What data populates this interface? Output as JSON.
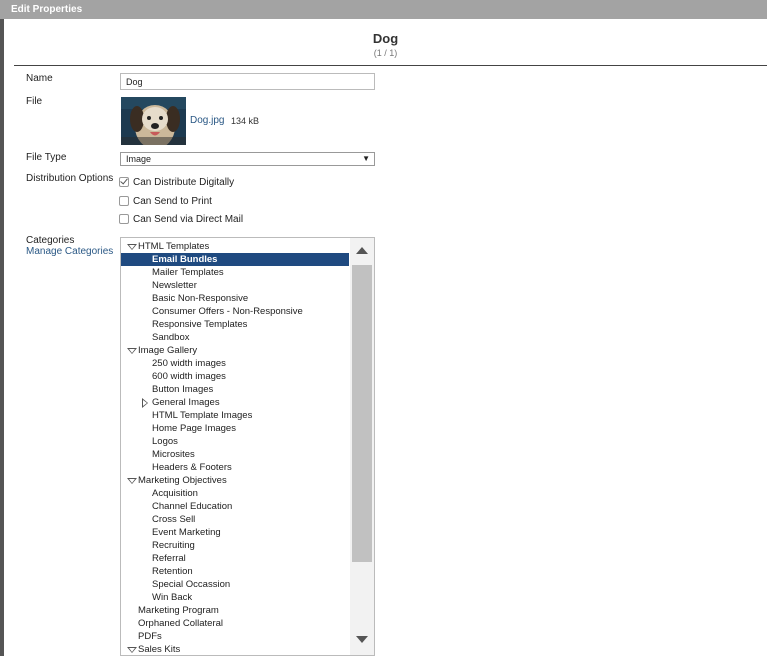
{
  "window": {
    "title": "Edit Properties"
  },
  "record": {
    "name": "Dog",
    "position": "(1 / 1)"
  },
  "fields": {
    "name_label": "Name",
    "name_value": "Dog",
    "file_label": "File",
    "file_name": "Dog.jpg",
    "file_size": "134 kB",
    "file_type_label": "File Type",
    "file_type_value": "Image",
    "distribution_label": "Distribution Options",
    "distribution_options": [
      {
        "label": "Can Distribute Digitally",
        "checked": true
      },
      {
        "label": "Can Send to Print",
        "checked": false
      },
      {
        "label": "Can Send via Direct Mail",
        "checked": false
      }
    ],
    "categories_label": "Categories",
    "manage_categories_link": "Manage Categories"
  },
  "categories": [
    {
      "label": "HTML Templates",
      "level": 0,
      "state": "expanded"
    },
    {
      "label": "Email Bundles",
      "level": 1,
      "selected": true
    },
    {
      "label": "Mailer Templates",
      "level": 1
    },
    {
      "label": "Newsletter",
      "level": 1
    },
    {
      "label": "Basic Non-Responsive",
      "level": 1
    },
    {
      "label": "Consumer Offers - Non-Responsive",
      "level": 1
    },
    {
      "label": "Responsive Templates",
      "level": 1
    },
    {
      "label": "Sandbox",
      "level": 1
    },
    {
      "label": "Image Gallery",
      "level": 0,
      "state": "expanded"
    },
    {
      "label": "250 width images",
      "level": 1
    },
    {
      "label": "600 width images",
      "level": 1
    },
    {
      "label": "Button Images",
      "level": 1
    },
    {
      "label": "General Images",
      "level": 1,
      "state": "collapsed"
    },
    {
      "label": "HTML Template Images",
      "level": 1
    },
    {
      "label": "Home Page Images",
      "level": 1
    },
    {
      "label": "Logos",
      "level": 1
    },
    {
      "label": "Microsites",
      "level": 1
    },
    {
      "label": "Headers & Footers",
      "level": 1
    },
    {
      "label": "Marketing Objectives",
      "level": 0,
      "state": "expanded"
    },
    {
      "label": "Acquisition",
      "level": 1
    },
    {
      "label": "Channel Education",
      "level": 1
    },
    {
      "label": "Cross Sell",
      "level": 1
    },
    {
      "label": "Event Marketing",
      "level": 1
    },
    {
      "label": "Recruiting",
      "level": 1
    },
    {
      "label": "Referral",
      "level": 1
    },
    {
      "label": "Retention",
      "level": 1
    },
    {
      "label": "Special Occassion",
      "level": 1
    },
    {
      "label": "Win Back",
      "level": 1
    },
    {
      "label": "Marketing Program",
      "level": 0
    },
    {
      "label": "Orphaned Collateral",
      "level": 0
    },
    {
      "label": "PDFs",
      "level": 0
    },
    {
      "label": "Sales Kits",
      "level": 0,
      "state": "expanded"
    }
  ],
  "colors": {
    "titlebar": "#a3a3a3",
    "selection": "#1f4a80",
    "link": "#2a5885"
  },
  "icons": {
    "file_type_dropdown": "caret-down-icon",
    "expanded": "triangle-down-icon",
    "collapsed": "triangle-right-icon"
  }
}
